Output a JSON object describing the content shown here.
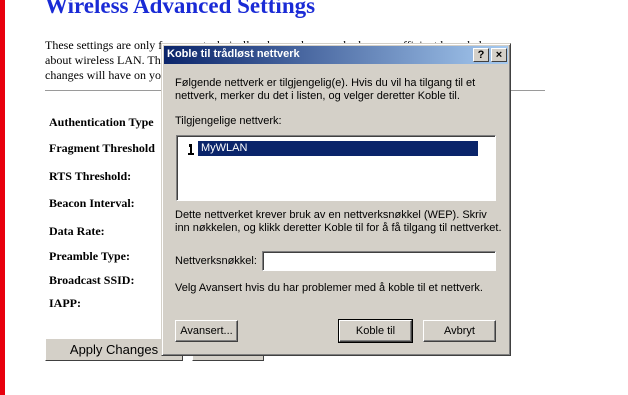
{
  "page": {
    "title": "Wireless Advanced Settings",
    "intro_lines": [
      "These settings are only for more technically advanced users who have a sufficient knowledge",
      "about wireless LAN. These settings should not be changed unless you know what effect the",
      "changes will have on your Access Point."
    ],
    "fields": [
      "Authentication Type",
      "Fragment Threshold",
      "RTS Threshold:",
      "Beacon Interval:",
      "Data Rate:",
      "Preamble Type:",
      "Broadcast SSID:",
      "IAPP:"
    ],
    "apply_label": "Apply Changes",
    "accent_color": "#1a2bd6",
    "left_bar_color": "#e8000d"
  },
  "dialog": {
    "title": "Koble til trådløst nettverk",
    "help_button": "?",
    "close_button": "×",
    "intro": [
      "Følgende nettverk er tilgjengelig(e). Hvis du vil ha tilgang til et",
      "nettverk, merker du det i listen, og velger deretter Koble til."
    ],
    "list_label": "Tilgjengelige nettverk:",
    "networks": [
      {
        "name": "MyWLAN",
        "icon": "wireless-network-icon",
        "selected": true
      }
    ],
    "wep_note": [
      "Dette nettverket krever bruk av en nettverksnøkkel (WEP). Skriv",
      "inn nøkkelen, og klikk deretter Koble til for å få tilgang til nettverket."
    ],
    "key_label": "Nettverksnøkkel:",
    "key_value": "",
    "advanced_hint": "Velg Avansert hvis du har problemer med å koble til et nettverk.",
    "buttons": {
      "advanced": "Avansert...",
      "connect": "Koble til",
      "cancel": "Avbryt"
    },
    "titlebar_color": "#0a246a",
    "selection_color": "#0a246a"
  }
}
